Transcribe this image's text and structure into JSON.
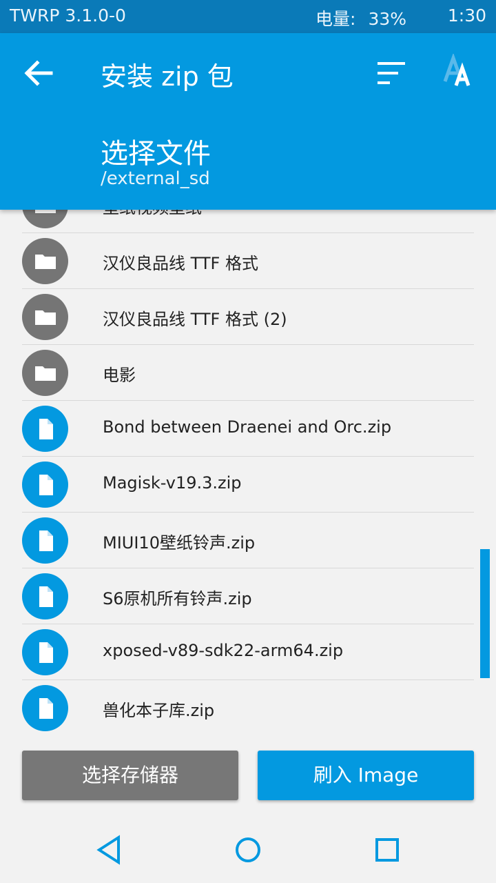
{
  "status_bar": {
    "left_text": "TWRP 3.1.0-0",
    "battery_label": "电量:",
    "battery_value": "33%",
    "time": "1:30"
  },
  "app_bar": {
    "title": "安装 zip 包",
    "subtitle": "选择文件",
    "path": "/external_sd",
    "icons": [
      "back-arrow-icon",
      "sort-icon",
      "font-size-icon"
    ]
  },
  "files": [
    {
      "name": "壁纸视频壁纸",
      "type": "folder"
    },
    {
      "name": "汉仪良品线 TTF 格式",
      "type": "folder"
    },
    {
      "name": "汉仪良品线 TTF 格式 (2)",
      "type": "folder"
    },
    {
      "name": "电影",
      "type": "folder"
    },
    {
      "name": "Bond between Draenei and Orc.zip",
      "type": "file"
    },
    {
      "name": "Magisk-v19.3.zip",
      "type": "file"
    },
    {
      "name": "MIUI10壁纸铃声.zip",
      "type": "file"
    },
    {
      "name": "S6原机所有铃声.zip",
      "type": "file"
    },
    {
      "name": "xposed-v89-sdk22-arm64.zip",
      "type": "file"
    },
    {
      "name": "兽化本子库.zip",
      "type": "file"
    }
  ],
  "buttons": {
    "select_storage": "选择存储器",
    "flash_image": "刷入 Image"
  },
  "colors": {
    "status_bar": "#0a7ab8",
    "accent": "#0399e0",
    "folder_icon_bg": "#757575",
    "secondary_button": "#777777",
    "background": "#f2f2f2"
  },
  "nav_icons": [
    "back-triangle-icon",
    "home-circle-icon",
    "recents-square-icon"
  ]
}
